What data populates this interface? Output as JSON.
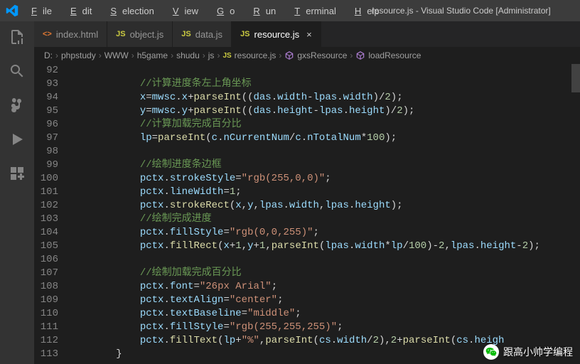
{
  "window": {
    "title": "resource.js - Visual Studio Code [Administrator]"
  },
  "menu": {
    "file": "File",
    "edit": "Edit",
    "selection": "Selection",
    "view": "View",
    "go": "Go",
    "run": "Run",
    "terminal": "Terminal",
    "help": "Help"
  },
  "tabs": [
    {
      "icon": "html",
      "iconText": "<>",
      "label": "index.html",
      "active": false
    },
    {
      "icon": "js",
      "iconText": "JS",
      "label": "object.js",
      "active": false
    },
    {
      "icon": "js",
      "iconText": "JS",
      "label": "data.js",
      "active": false
    },
    {
      "icon": "js",
      "iconText": "JS",
      "label": "resource.js",
      "active": true
    }
  ],
  "breadcrumb": {
    "parts": [
      "D:",
      "phpstudy",
      "WWW",
      "h5game",
      "shudu",
      "js",
      "resource.js",
      "gxsResource",
      "loadResource"
    ],
    "fileIconAt": 6,
    "cubeIconAt": [
      7,
      8
    ]
  },
  "code": {
    "startLine": 92,
    "lines": [
      {
        "n": 92,
        "t": []
      },
      {
        "n": 93,
        "t": [
          [
            "comment",
            "//计算进度条左上角坐标"
          ]
        ]
      },
      {
        "n": 94,
        "t": [
          [
            "ident",
            "x"
          ],
          [
            "op",
            "="
          ],
          [
            "ident",
            "mwsc"
          ],
          [
            "punc",
            "."
          ],
          [
            "ident",
            "x"
          ],
          [
            "op",
            "+"
          ],
          [
            "func",
            "parseInt"
          ],
          [
            "punc",
            "(("
          ],
          [
            "ident",
            "das"
          ],
          [
            "punc",
            "."
          ],
          [
            "ident",
            "width"
          ],
          [
            "op",
            "-"
          ],
          [
            "ident",
            "lpas"
          ],
          [
            "punc",
            "."
          ],
          [
            "ident",
            "width"
          ],
          [
            "punc",
            ")"
          ],
          [
            "op",
            "/"
          ],
          [
            "num",
            "2"
          ],
          [
            "punc",
            ");"
          ]
        ]
      },
      {
        "n": 95,
        "t": [
          [
            "ident",
            "y"
          ],
          [
            "op",
            "="
          ],
          [
            "ident",
            "mwsc"
          ],
          [
            "punc",
            "."
          ],
          [
            "ident",
            "y"
          ],
          [
            "op",
            "+"
          ],
          [
            "func",
            "parseInt"
          ],
          [
            "punc",
            "(("
          ],
          [
            "ident",
            "das"
          ],
          [
            "punc",
            "."
          ],
          [
            "ident",
            "height"
          ],
          [
            "op",
            "-"
          ],
          [
            "ident",
            "lpas"
          ],
          [
            "punc",
            "."
          ],
          [
            "ident",
            "height"
          ],
          [
            "punc",
            ")"
          ],
          [
            "op",
            "/"
          ],
          [
            "num",
            "2"
          ],
          [
            "punc",
            ");"
          ]
        ]
      },
      {
        "n": 96,
        "t": [
          [
            "comment",
            "//计算加载完成百分比"
          ]
        ]
      },
      {
        "n": 97,
        "t": [
          [
            "ident",
            "lp"
          ],
          [
            "op",
            "="
          ],
          [
            "func",
            "parseInt"
          ],
          [
            "punc",
            "("
          ],
          [
            "ident",
            "c"
          ],
          [
            "punc",
            "."
          ],
          [
            "ident",
            "nCurrentNum"
          ],
          [
            "op",
            "/"
          ],
          [
            "ident",
            "c"
          ],
          [
            "punc",
            "."
          ],
          [
            "ident",
            "nTotalNum"
          ],
          [
            "op",
            "*"
          ],
          [
            "num",
            "100"
          ],
          [
            "punc",
            ");"
          ]
        ]
      },
      {
        "n": 98,
        "t": []
      },
      {
        "n": 99,
        "t": [
          [
            "comment",
            "//绘制进度条边框"
          ]
        ]
      },
      {
        "n": 100,
        "t": [
          [
            "ident",
            "pctx"
          ],
          [
            "punc",
            "."
          ],
          [
            "ident",
            "strokeStyle"
          ],
          [
            "op",
            "="
          ],
          [
            "str",
            "\"rgb(255,0,0)\""
          ],
          [
            "punc",
            ";"
          ]
        ]
      },
      {
        "n": 101,
        "t": [
          [
            "ident",
            "pctx"
          ],
          [
            "punc",
            "."
          ],
          [
            "ident",
            "lineWidth"
          ],
          [
            "op",
            "="
          ],
          [
            "num",
            "1"
          ],
          [
            "punc",
            ";"
          ]
        ]
      },
      {
        "n": 102,
        "t": [
          [
            "ident",
            "pctx"
          ],
          [
            "punc",
            "."
          ],
          [
            "func",
            "strokeRect"
          ],
          [
            "punc",
            "("
          ],
          [
            "ident",
            "x"
          ],
          [
            "punc",
            ","
          ],
          [
            "ident",
            "y"
          ],
          [
            "punc",
            ","
          ],
          [
            "ident",
            "lpas"
          ],
          [
            "punc",
            "."
          ],
          [
            "ident",
            "width"
          ],
          [
            "punc",
            ","
          ],
          [
            "ident",
            "lpas"
          ],
          [
            "punc",
            "."
          ],
          [
            "ident",
            "height"
          ],
          [
            "punc",
            ");"
          ]
        ]
      },
      {
        "n": 103,
        "t": [
          [
            "comment",
            "//绘制完成进度"
          ]
        ]
      },
      {
        "n": 104,
        "t": [
          [
            "ident",
            "pctx"
          ],
          [
            "punc",
            "."
          ],
          [
            "ident",
            "fillStyle"
          ],
          [
            "op",
            "="
          ],
          [
            "str",
            "\"rgb(0,0,255)\""
          ],
          [
            "punc",
            ";"
          ]
        ]
      },
      {
        "n": 105,
        "t": [
          [
            "ident",
            "pctx"
          ],
          [
            "punc",
            "."
          ],
          [
            "func",
            "fillRect"
          ],
          [
            "punc",
            "("
          ],
          [
            "ident",
            "x"
          ],
          [
            "op",
            "+"
          ],
          [
            "num",
            "1"
          ],
          [
            "punc",
            ","
          ],
          [
            "ident",
            "y"
          ],
          [
            "op",
            "+"
          ],
          [
            "num",
            "1"
          ],
          [
            "punc",
            ","
          ],
          [
            "func",
            "parseInt"
          ],
          [
            "punc",
            "("
          ],
          [
            "ident",
            "lpas"
          ],
          [
            "punc",
            "."
          ],
          [
            "ident",
            "width"
          ],
          [
            "op",
            "*"
          ],
          [
            "ident",
            "lp"
          ],
          [
            "op",
            "/"
          ],
          [
            "num",
            "100"
          ],
          [
            "punc",
            ")"
          ],
          [
            "op",
            "-"
          ],
          [
            "num",
            "2"
          ],
          [
            "punc",
            ","
          ],
          [
            "ident",
            "lpas"
          ],
          [
            "punc",
            "."
          ],
          [
            "ident",
            "height"
          ],
          [
            "op",
            "-"
          ],
          [
            "num",
            "2"
          ],
          [
            "punc",
            ");"
          ]
        ]
      },
      {
        "n": 106,
        "t": []
      },
      {
        "n": 107,
        "t": [
          [
            "comment",
            "//绘制加载完成百分比"
          ]
        ]
      },
      {
        "n": 108,
        "t": [
          [
            "ident",
            "pctx"
          ],
          [
            "punc",
            "."
          ],
          [
            "ident",
            "font"
          ],
          [
            "op",
            "="
          ],
          [
            "str",
            "\"26px Arial\""
          ],
          [
            "punc",
            ";"
          ]
        ]
      },
      {
        "n": 109,
        "t": [
          [
            "ident",
            "pctx"
          ],
          [
            "punc",
            "."
          ],
          [
            "ident",
            "textAlign"
          ],
          [
            "op",
            "="
          ],
          [
            "str",
            "\"center\""
          ],
          [
            "punc",
            ";"
          ]
        ]
      },
      {
        "n": 110,
        "t": [
          [
            "ident",
            "pctx"
          ],
          [
            "punc",
            "."
          ],
          [
            "ident",
            "textBaseline"
          ],
          [
            "op",
            "="
          ],
          [
            "str",
            "\"middle\""
          ],
          [
            "punc",
            ";"
          ]
        ]
      },
      {
        "n": 111,
        "t": [
          [
            "ident",
            "pctx"
          ],
          [
            "punc",
            "."
          ],
          [
            "ident",
            "fillStyle"
          ],
          [
            "op",
            "="
          ],
          [
            "str",
            "\"rgb(255,255,255)\""
          ],
          [
            "punc",
            ";"
          ]
        ]
      },
      {
        "n": 112,
        "t": [
          [
            "ident",
            "pctx"
          ],
          [
            "punc",
            "."
          ],
          [
            "func",
            "fillText"
          ],
          [
            "punc",
            "("
          ],
          [
            "ident",
            "lp"
          ],
          [
            "op",
            "+"
          ],
          [
            "str",
            "\"%\""
          ],
          [
            "punc",
            ","
          ],
          [
            "func",
            "parseInt"
          ],
          [
            "punc",
            "("
          ],
          [
            "ident",
            "cs"
          ],
          [
            "punc",
            "."
          ],
          [
            "ident",
            "width"
          ],
          [
            "op",
            "/"
          ],
          [
            "num",
            "2"
          ],
          [
            "punc",
            ")"
          ],
          [
            "punc",
            ","
          ],
          [
            "num",
            "2"
          ],
          [
            "op",
            "+"
          ],
          [
            "func",
            "parseInt"
          ],
          [
            "punc",
            "("
          ],
          [
            "ident",
            "cs"
          ],
          [
            "punc",
            "."
          ],
          [
            "ident",
            "heigh"
          ]
        ]
      },
      {
        "n": 113,
        "t": [
          [
            "punc",
            "}"
          ]
        ],
        "indent": 2
      }
    ],
    "defaultIndent": 3
  },
  "watermark": {
    "text": "跟高小帅学编程"
  }
}
